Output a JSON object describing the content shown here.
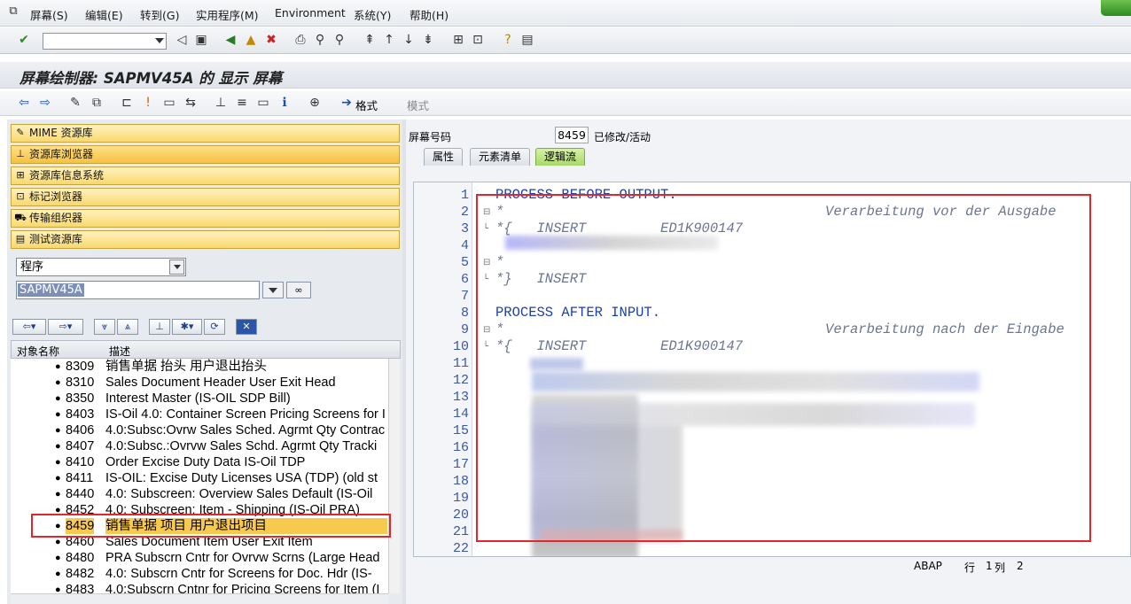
{
  "menu": {
    "items": [
      "屏幕(S)",
      "编辑(E)",
      "转到(G)",
      "实用程序(M)",
      "Environment",
      "系统(Y)",
      "帮助(H)"
    ]
  },
  "toolbar": {
    "command_value": ""
  },
  "title": "屏幕绘制器: SAPMV45A 的 显示 屏幕",
  "app_toolbar": {
    "format_label": "格式",
    "mode_label": "模式"
  },
  "nav": {
    "items": [
      "MIME 资源库",
      "资源库浏览器",
      "资源库信息系统",
      "标记浏览器",
      "传输组织器",
      "测试资源库"
    ],
    "active_index": 1
  },
  "object_type": "程序",
  "program_name": "SAPMV45A",
  "tree": {
    "col_name": "对象名称",
    "col_desc": "描述",
    "rows": [
      {
        "num": "8309",
        "desc": "销售单据          抬头          用户退出抬头"
      },
      {
        "num": "8310",
        "desc": "Sales Document       Header     User Exit Head"
      },
      {
        "num": "8350",
        "desc": "Interest Master (IS-OIL SDP Bill)"
      },
      {
        "num": "8403",
        "desc": "IS-Oil 4.0: Container Screen Pricing Screens for I"
      },
      {
        "num": "8406",
        "desc": "4.0:Subsc:Ovrw Sales Sched. Agrmt Qty Contrac"
      },
      {
        "num": "8407",
        "desc": "4.0:Subsc.:Ovrvw Sales Schd. Agrmt Qty Tracki"
      },
      {
        "num": "8410",
        "desc": "Order          Excise Duty Data      IS-Oil   TDP"
      },
      {
        "num": "8411",
        "desc": "IS-OIL: Excise Duty Licenses USA (TDP) (old st"
      },
      {
        "num": "8440",
        "desc": "4.0: Subscreen: Overview Sales    Default (IS-Oil"
      },
      {
        "num": "8452",
        "desc": "4.0: Subscreen: Item - Shipping (IS-Oil PRA)"
      },
      {
        "num": "8459",
        "desc": "销售单据          项目          用户退出项目"
      },
      {
        "num": "8460",
        "desc": "Sales Document       Item       User Exit Item"
      },
      {
        "num": "8480",
        "desc": "PRA Subscrn Cntr for Ovrvw Scrns (Large Head"
      },
      {
        "num": "8482",
        "desc": "4.0: Subscrn Cntr for Screens for Doc. Hdr (IS-"
      },
      {
        "num": "8483",
        "desc": "4.0:Subscrn Cntnr for Pricing Screens for Item (I"
      }
    ],
    "selected_index": 10
  },
  "screen": {
    "label": "屏幕号码",
    "number": "8459",
    "status": "已修改/活动"
  },
  "tabs": [
    "属性",
    "元素清单",
    "逻辑流"
  ],
  "active_tab": 2,
  "code_lines": [
    {
      "n": "1",
      "fold": "",
      "text": "PROCESS BEFORE OUTPUT.",
      "cm": false
    },
    {
      "n": "2",
      "fold": "⊟",
      "text": "*                                       Verarbeitung vor der Ausgabe",
      "cm": true
    },
    {
      "n": "3",
      "fold": "└",
      "text": "*{   INSERT         ED1K900147                                                  1",
      "cm": true
    },
    {
      "n": "4",
      "fold": "",
      "text": "",
      "cm": false
    },
    {
      "n": "5",
      "fold": "⊟",
      "text": "*",
      "cm": true
    },
    {
      "n": "6",
      "fold": "└",
      "text": "*}   INSERT",
      "cm": true
    },
    {
      "n": "7",
      "fold": "",
      "text": "",
      "cm": false
    },
    {
      "n": "8",
      "fold": "",
      "text": "PROCESS AFTER INPUT.",
      "cm": false
    },
    {
      "n": "9",
      "fold": "⊟",
      "text": "*                                       Verarbeitung nach der Eingabe",
      "cm": true
    },
    {
      "n": "10",
      "fold": "└",
      "text": "*{   INSERT         ED1K900147                                                  1",
      "cm": true
    },
    {
      "n": "11",
      "fold": "",
      "text": "",
      "cm": false
    },
    {
      "n": "12",
      "fold": "",
      "text": "",
      "cm": false
    },
    {
      "n": "13",
      "fold": "",
      "text": "",
      "cm": false
    },
    {
      "n": "14",
      "fold": "",
      "text": "",
      "cm": false
    },
    {
      "n": "15",
      "fold": "",
      "text": "",
      "cm": false
    },
    {
      "n": "16",
      "fold": "",
      "text": "",
      "cm": false
    },
    {
      "n": "17",
      "fold": "",
      "text": "",
      "cm": false
    },
    {
      "n": "18",
      "fold": "",
      "text": "",
      "cm": false
    },
    {
      "n": "19",
      "fold": "",
      "text": "",
      "cm": false
    },
    {
      "n": "20",
      "fold": "",
      "text": "",
      "cm": false
    },
    {
      "n": "21",
      "fold": "",
      "text": "",
      "cm": false
    },
    {
      "n": "22",
      "fold": "",
      "text": "",
      "cm": false
    }
  ],
  "status": {
    "lang": "ABAP",
    "row_label": "行",
    "row": "1",
    "col_label": "列",
    "col": "2"
  },
  "colors": {
    "accent_red": "#e0272b",
    "selection": "#f7c94e",
    "code_blue": "#1d3fa8"
  }
}
